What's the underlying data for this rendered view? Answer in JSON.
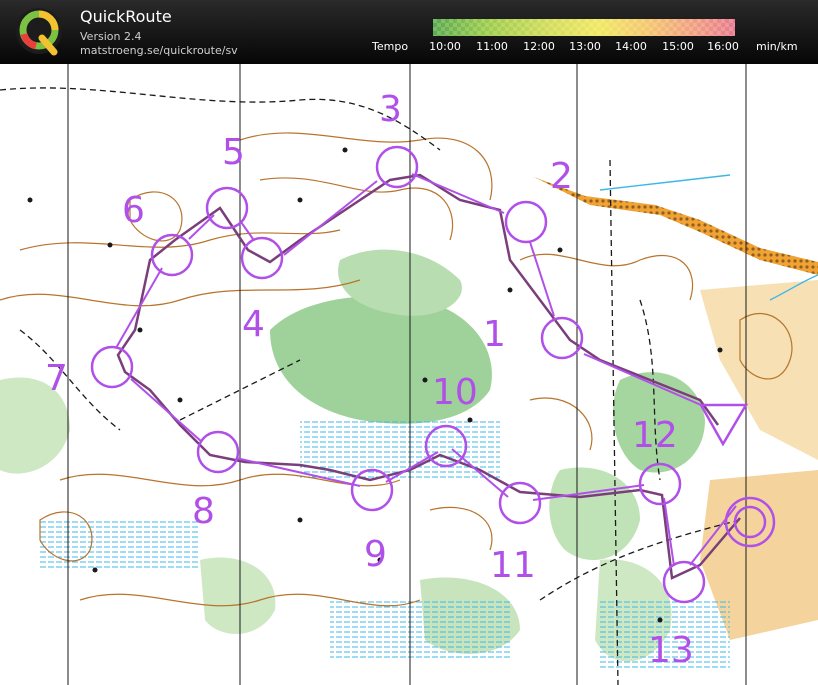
{
  "app": {
    "name": "QuickRoute",
    "version": "Version 2.4",
    "url": "matstroeng.se/quickroute/sv",
    "logo_letter": "Q"
  },
  "tempo_scale": {
    "label": "Tempo",
    "ticks": [
      "10:00",
      "11:00",
      "12:00",
      "13:00",
      "14:00",
      "15:00",
      "16:00"
    ],
    "unit": "min/km",
    "colors": [
      "#5aaa4e",
      "#9ccc4a",
      "#d2dc58",
      "#f0e860",
      "#f4c46e",
      "#f09a82",
      "#e87a8e"
    ]
  },
  "map": {
    "course_color": "#b050e8",
    "route_color": "#7a3f7a",
    "controls": [
      "1",
      "2",
      "3",
      "4",
      "5",
      "6",
      "7",
      "8",
      "9",
      "10",
      "11",
      "12",
      "13"
    ]
  }
}
